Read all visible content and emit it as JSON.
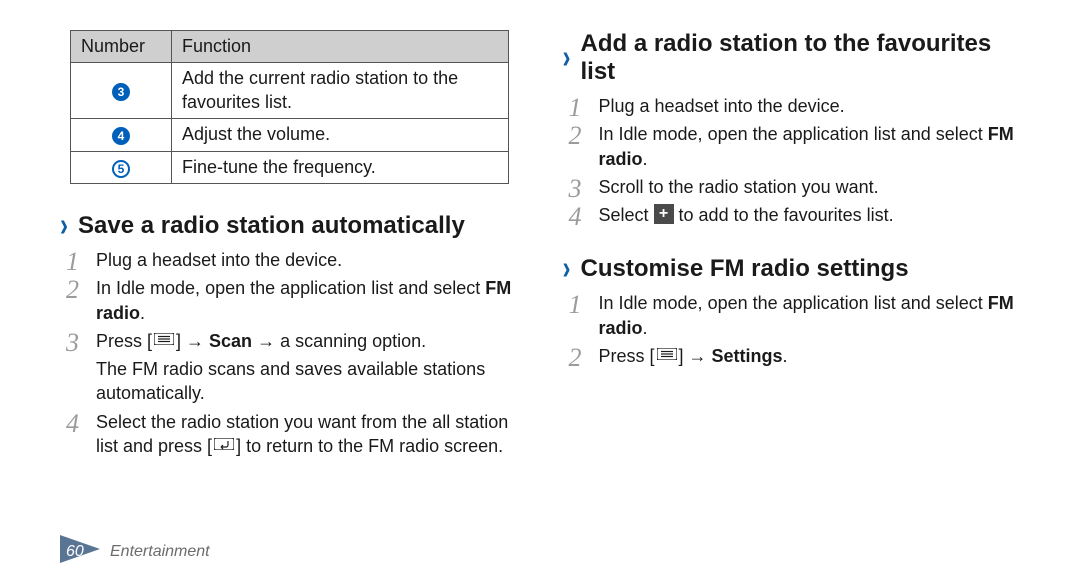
{
  "table": {
    "headers": {
      "col1": "Number",
      "col2": "Function"
    },
    "rows": [
      {
        "num": "3",
        "style": "filled",
        "fn": "Add the current radio station to the favourites list."
      },
      {
        "num": "4",
        "style": "filled",
        "fn": "Adjust the volume."
      },
      {
        "num": "5",
        "style": "outline",
        "fn": "Fine-tune the frequency."
      }
    ]
  },
  "section_save": {
    "title": "Save a radio station automatically",
    "steps": {
      "s1": "Plug a headset into the device.",
      "s2a": "In Idle mode, open the application list and select ",
      "s2b": "FM radio",
      "s2c": ".",
      "s3a": "Press [",
      "s3b": "] → ",
      "s3c": "Scan",
      "s3d": " → a scanning option.",
      "s3_sub": "The FM radio scans and saves available stations automatically.",
      "s4a": "Select the radio station you want from the all station list and press [",
      "s4b": "] to return to the FM radio screen."
    }
  },
  "section_add": {
    "title": "Add a radio station to the favourites list",
    "steps": {
      "s1": "Plug a headset into the device.",
      "s2a": "In Idle mode, open the application list and select ",
      "s2b": "FM radio",
      "s2c": ".",
      "s3": "Scroll to the radio station you want.",
      "s4a": "Select ",
      "s4b": " to add to the favourites list."
    }
  },
  "section_custom": {
    "title": "Customise FM radio settings",
    "steps": {
      "s1a": "In Idle mode, open the application list and select ",
      "s1b": "FM radio",
      "s1c": ".",
      "s2a": "Press [",
      "s2b": "] → ",
      "s2c": "Settings",
      "s2d": "."
    }
  },
  "icons": {
    "menu": "menu-icon",
    "back": "back-icon",
    "plus": "plus-icon"
  },
  "footer": {
    "page": "60",
    "section": "Entertainment"
  }
}
